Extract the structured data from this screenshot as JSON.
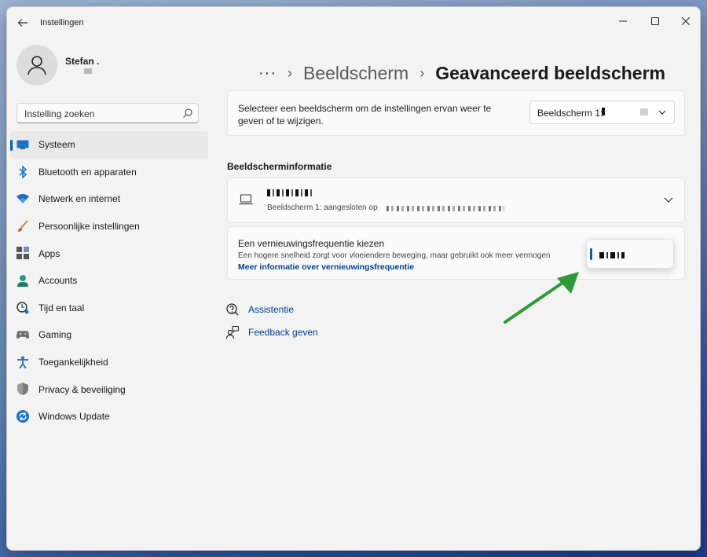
{
  "window": {
    "title": "Instellingen",
    "controls": {
      "minimize": "minimize-icon",
      "maximize": "maximize-icon",
      "close": "close-icon"
    }
  },
  "user": {
    "name": "Stefan ."
  },
  "search": {
    "placeholder": "Instelling zoeken"
  },
  "sidebar": {
    "items": [
      {
        "label": "Systeem",
        "icon": "system-icon",
        "active": true
      },
      {
        "label": "Bluetooth en apparaten",
        "icon": "bluetooth-icon"
      },
      {
        "label": "Netwerk en internet",
        "icon": "wifi-icon"
      },
      {
        "label": "Persoonlijke instellingen",
        "icon": "brush-icon"
      },
      {
        "label": "Apps",
        "icon": "apps-icon"
      },
      {
        "label": "Accounts",
        "icon": "accounts-icon"
      },
      {
        "label": "Tijd en taal",
        "icon": "time-language-icon"
      },
      {
        "label": "Gaming",
        "icon": "gamepad-icon"
      },
      {
        "label": "Toegankelijkheid",
        "icon": "accessibility-icon"
      },
      {
        "label": "Privacy & beveiliging",
        "icon": "shield-icon"
      },
      {
        "label": "Windows Update",
        "icon": "update-icon"
      }
    ]
  },
  "breadcrumb": {
    "more": "···",
    "separator": "›",
    "parent": "Beeldscherm",
    "current": "Geavanceerd beeldscherm"
  },
  "display_select": {
    "description": "Selecteer een beeldscherm om de instellingen ervan weer te geven of te wijzigen.",
    "dropdown_label": "Beeldscherm 1:"
  },
  "display_info": {
    "section_title": "Beeldscherminformatie",
    "subtitle_prefix": "Beeldscherm 1: aangesloten op"
  },
  "refresh_rate": {
    "title": "Een vernieuwingsfrequentie kiezen",
    "description": "Een hogere snelheid zorgt voor vloeiendere beweging, maar gebruikt ook meer vermogen",
    "link": "Meer informatie over vernieuwingsfrequentie"
  },
  "help_links": [
    {
      "label": "Assistentie",
      "icon": "help-icon"
    },
    {
      "label": "Feedback geven",
      "icon": "feedback-icon"
    }
  ],
  "colors": {
    "accent": "#005fb8",
    "link": "#003e92",
    "annotation_arrow": "#2e9a3a"
  }
}
